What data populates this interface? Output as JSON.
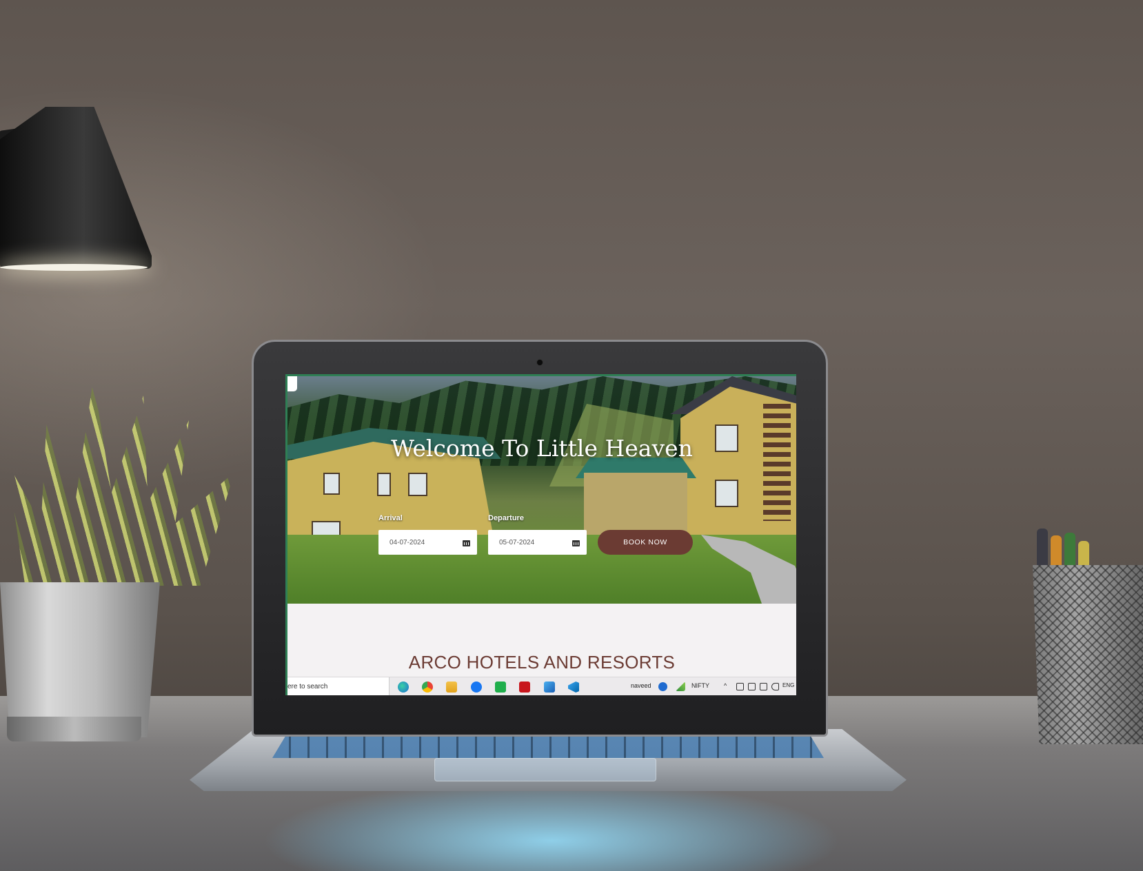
{
  "hero": {
    "title": "Welcome To Little Heaven"
  },
  "booking": {
    "arrival_label": "Arrival",
    "arrival_value": "04-07-2024",
    "departure_label": "Departure",
    "departure_value": "05-07-2024",
    "book_button": "BOOK NOW"
  },
  "section": {
    "title": "ARCO HOTELS AND RESORTS"
  },
  "taskbar": {
    "search_text": "ere to search",
    "apps": [
      "edge-icon",
      "chrome-icon",
      "file-explorer-icon",
      "facebook-icon",
      "whatsapp-icon",
      "acrobat-icon",
      "photos-icon",
      "vscode-icon"
    ],
    "user_label": "naveed",
    "ticker_label": "NIFTY",
    "lang_label": "ENG"
  },
  "colors": {
    "accent": "#6b3b33",
    "title_color": "#6b3b33"
  }
}
